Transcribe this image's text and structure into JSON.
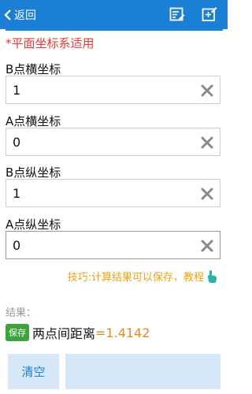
{
  "header": {
    "back_label": "返回"
  },
  "note": "*平面坐标系适用",
  "fields": [
    {
      "label": "B点横坐标",
      "value": "1"
    },
    {
      "label": "A点横坐标",
      "value": "0"
    },
    {
      "label": "B点纵坐标",
      "value": "1"
    },
    {
      "label": "A点纵坐标",
      "value": "0"
    }
  ],
  "tip": {
    "text": "技巧:计算结果可以保存，",
    "link": "教程"
  },
  "result": {
    "label": "结果：",
    "save_badge": "保存",
    "title": "两点间距离",
    "value": "=1.4142"
  },
  "buttons": {
    "clear": "清空",
    "second": ""
  },
  "colors": {
    "header": "#1b7fd6",
    "note": "#e23b3b",
    "tip": "#f0a10e",
    "result_value": "#e58b26",
    "button_bg": "#d6e8f7",
    "save_badge": "#3aa53a"
  },
  "icons": {
    "back": "chevron-left-icon",
    "edit_list": "edit-list-icon",
    "new_note": "new-note-icon",
    "clear": "close-icon",
    "tip_hand": "hand-pointer-icon"
  }
}
